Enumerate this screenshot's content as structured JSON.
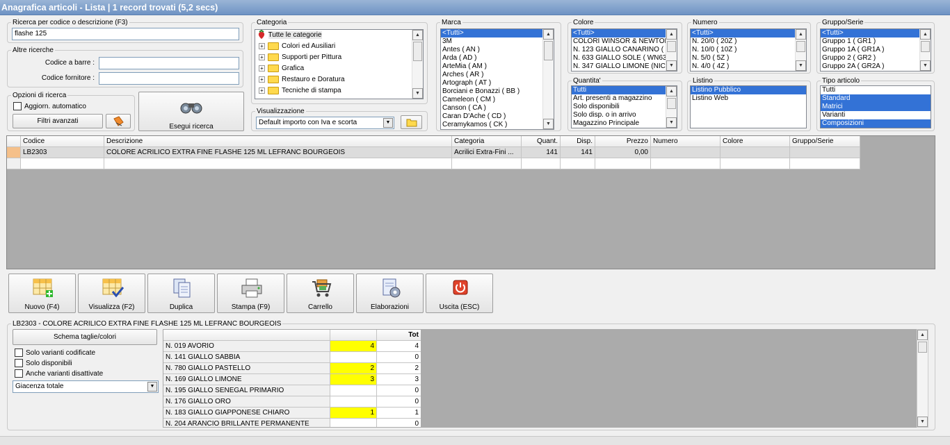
{
  "title": "Anagrafica articoli  - Lista | 1 record trovati (5,2 secs)",
  "search": {
    "group_label": "Ricerca per codice o descrizione (F3)",
    "value": "flashe 125"
  },
  "other": {
    "group_label": "Altre ricerche",
    "barcode_label": "Codice a barre :",
    "supplier_label": "Codice fornitore :",
    "barcode_value": "",
    "supplier_value": ""
  },
  "options": {
    "group_label": "Opzioni di ricerca",
    "auto_label": "Aggiorn. automatico",
    "advanced_label": "Filtri avanzati",
    "search_label": "Esegui ricerca"
  },
  "categoria": {
    "label": "Categoria",
    "root": "Tutte le categorie",
    "items": [
      "Colori ed Ausiliari",
      "Supporti per Pittura",
      "Grafica",
      "Restauro e Doratura",
      "Tecniche di stampa"
    ]
  },
  "visualizzazione": {
    "label": "Visualizzazione",
    "value": "Default importo con Iva e scorta"
  },
  "marca": {
    "label": "Marca",
    "items": [
      "<Tutti>",
      "3M",
      "Antes ( AN )",
      "Arda ( AD )",
      "ArteMia ( AM )",
      "Arches ( AR )",
      "Artograph ( AT )",
      "Borciani e Bonazzi ( BB )",
      "Cameleon ( CM )",
      "Canson ( CA )",
      "Caran D'Ache ( CD )",
      "Ceramykamos ( CK )"
    ]
  },
  "colore": {
    "label": "Colore",
    "items": [
      "<Tutti>",
      "COLORI WINSOR & NEWTON",
      "N. 123 GIALLO CANARINO (",
      "N. 633 GIALLO SOLE ( WN63",
      "N. 347 GIALLO LIMONE (NIC"
    ]
  },
  "numero": {
    "label": "Numero",
    "items": [
      "<Tutti>",
      "N. 20/0 ( 20Z )",
      "N. 10/0 ( 10Z )",
      "N. 5/0 ( 5Z )",
      "N. 4/0 ( 4Z )"
    ]
  },
  "gruppo": {
    "label": "Gruppo/Serie",
    "items": [
      "<Tutti>",
      "Gruppo 1 ( GR1 )",
      "Gruppo 1A ( GR1A )",
      "Gruppo 2 ( GR2 )",
      "Gruppo 2A ( GR2A )"
    ]
  },
  "quantita": {
    "label": "Quantita'",
    "items": [
      "Tutti",
      "Art. presenti a magazzino",
      "Solo disponibili",
      "Solo disp. o in arrivo",
      "Magazzino Principale"
    ]
  },
  "listino": {
    "label": "Listino",
    "items": [
      "Listino Pubblico",
      "Listino Web"
    ]
  },
  "tipo": {
    "label": "Tipo articolo",
    "items": [
      "Tutti",
      "Standard",
      "Matrici",
      "Varianti",
      "Composizioni"
    ]
  },
  "grid": {
    "headers": [
      "Codice",
      "Descrizione",
      "Categoria",
      "Quant.",
      "Disp.",
      "Prezzo",
      "Numero",
      "Colore",
      "Gruppo/Serie"
    ],
    "rows": [
      [
        "LB2303",
        "COLORE ACRILICO EXTRA FINE FLASHE 125 ML LEFRANC BOURGEOIS",
        "Acrilici Extra-Fini ...",
        "141",
        "141",
        "0,00",
        "",
        "",
        ""
      ]
    ]
  },
  "toolbar": {
    "new": "Nuovo (F4)",
    "view": "Visualizza (F2)",
    "dup": "Duplica",
    "print": "Stampa (F9)",
    "cart": "Carrello",
    "proc": "Elaborazioni",
    "exit": "Uscita (ESC)"
  },
  "detail": {
    "label": "LB2303 - COLORE ACRILICO EXTRA FINE FLASHE 125 ML LEFRANC BOURGEOIS",
    "schema_btn": "Schema taglie/colori",
    "chk1": "Solo varianti codificate",
    "chk2": "Solo disponibili",
    "chk3": "Anche varianti disattivate",
    "giacenza": "Giacenza totale",
    "tot_header": "Tot",
    "variants": [
      {
        "name": "N. 019 AVORIO",
        "q": "4",
        "tot": "4"
      },
      {
        "name": "N. 141 GIALLO SABBIA",
        "q": "",
        "tot": "0"
      },
      {
        "name": "N. 780 GIALLO PASTELLO",
        "q": "2",
        "tot": "2"
      },
      {
        "name": "N. 169 GIALLO LIMONE",
        "q": "3",
        "tot": "3"
      },
      {
        "name": "N. 195 GIALLO SENEGAL PRIMARIO",
        "q": "",
        "tot": "0"
      },
      {
        "name": "N. 176 GIALLO ORO",
        "q": "",
        "tot": "0"
      },
      {
        "name": "N. 183 GIALLO GIAPPONESE CHIARO",
        "q": "1",
        "tot": "1"
      },
      {
        "name": "N. 204 ARANCIO BRILLANTE PERMANENTE",
        "q": "",
        "tot": "0"
      }
    ]
  },
  "colors": {
    "titlebar": "#7a9cc8",
    "selection": "#3372d6",
    "highlight": "#ffff00",
    "grid_bg": "#ababab"
  }
}
